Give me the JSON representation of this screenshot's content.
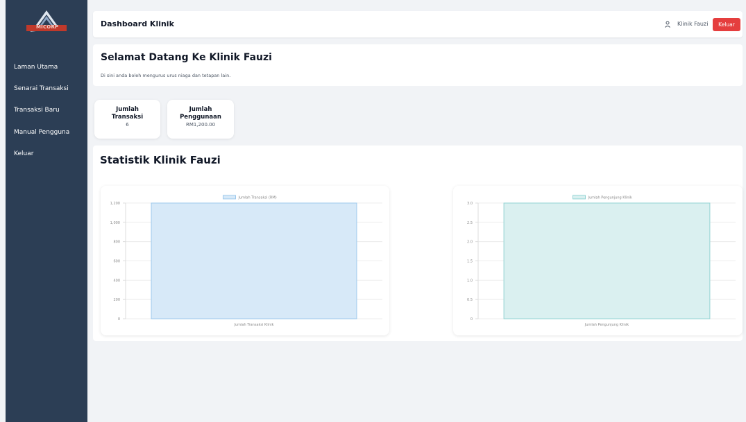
{
  "sidebar": {
    "logo_text": "MICORP",
    "items": [
      {
        "label": "Laman Utama"
      },
      {
        "label": "Senarai Transaksi"
      },
      {
        "label": "Transaksi Baru"
      },
      {
        "label": "Manual Pengguna"
      },
      {
        "label": "Keluar"
      }
    ]
  },
  "header": {
    "title": "Dashboard Klinik",
    "user_name": "Klinik Fauzi",
    "logout_label": "Keluar"
  },
  "welcome": {
    "title": "Selamat Datang Ke Klinik Fauzi",
    "subtitle": "Di sini anda boleh mengurus urus niaga dan tetapan lain."
  },
  "stats": [
    {
      "label_line1": "Jumlah",
      "label_line2": "Transaksi",
      "value": "6"
    },
    {
      "label_line1": "Jumlah",
      "label_line2": "Penggunaan",
      "value": "RM1,200.00"
    }
  ],
  "section": {
    "title": "Statistik Klinik Fauzi"
  },
  "colors": {
    "sidebar": "#2c3e55",
    "accent_red": "#e53e3e",
    "chart1_fill": "#d7e9f8",
    "chart1_stroke": "#9cc9ec",
    "chart2_fill": "#daf0f0",
    "chart2_stroke": "#93d3d3"
  },
  "icons": {
    "user": "user-icon",
    "logo": "micorp-logo"
  },
  "chart_data": [
    {
      "type": "bar",
      "categories": [
        "Jumlah Transaksi Klinik"
      ],
      "series": [
        {
          "name": "Jumlah Transaksi (RM)",
          "values": [
            1200
          ]
        }
      ],
      "yticks": [
        "0",
        "200",
        "400",
        "600",
        "800",
        "1,000",
        "1,200"
      ],
      "ylim": [
        0,
        1200
      ],
      "grid": true,
      "legend": "top-center"
    },
    {
      "type": "bar",
      "categories": [
        "Jumlah Pengunjung Klinik"
      ],
      "series": [
        {
          "name": "Jumlah Pengunjung Klinik",
          "values": [
            3
          ]
        }
      ],
      "yticks": [
        "0",
        "0.5",
        "1.0",
        "1.5",
        "2.0",
        "2.5",
        "3.0"
      ],
      "ylim": [
        0,
        3
      ],
      "grid": true,
      "legend": "top-center"
    }
  ]
}
